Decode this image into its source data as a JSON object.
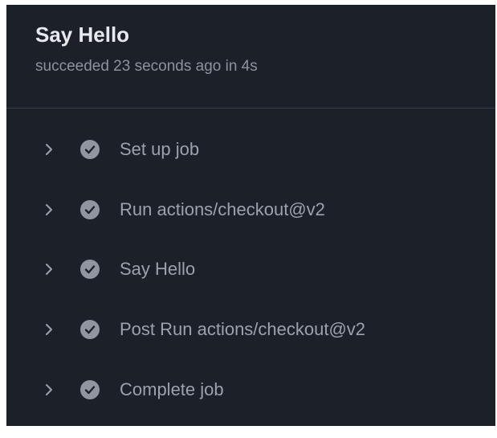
{
  "job": {
    "title": "Say Hello",
    "status": "succeeded 23 seconds ago in 4s"
  },
  "steps": [
    {
      "label": "Set up job",
      "icon": "check-circle-icon"
    },
    {
      "label": "Run actions/checkout@v2",
      "icon": "check-circle-icon"
    },
    {
      "label": "Say Hello",
      "icon": "check-circle-icon"
    },
    {
      "label": "Post Run actions/checkout@v2",
      "icon": "check-circle-icon"
    },
    {
      "label": "Complete job",
      "icon": "check-circle-icon"
    }
  ]
}
